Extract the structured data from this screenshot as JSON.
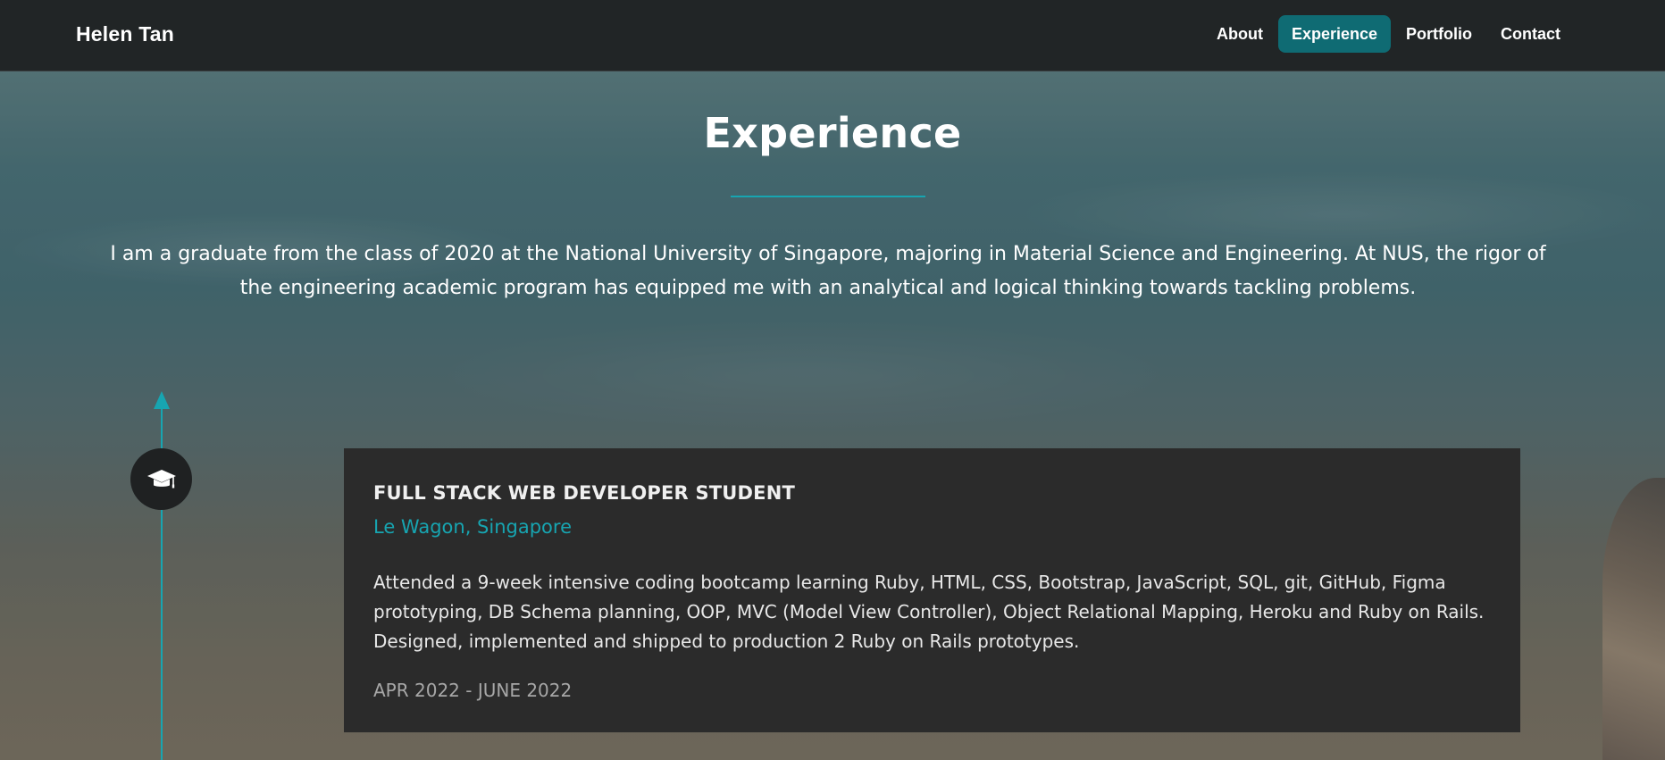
{
  "colors": {
    "navbar_bg": "#212526",
    "accent": "#17a5b1",
    "active_nav_bg": "#0f6b73",
    "card_bg": "#2b2b2b"
  },
  "brand": {
    "name": "Helen Tan"
  },
  "nav": {
    "items": [
      {
        "label": "About"
      },
      {
        "label": "Experience"
      },
      {
        "label": "Portfolio"
      },
      {
        "label": "Contact"
      }
    ],
    "active": "Experience"
  },
  "experience": {
    "title": "Experience",
    "intro": "I am a graduate from the class of 2020 at the National University of Singapore, majoring in Material Science and Engineering. At NUS, the rigor of the engineering academic program has equipped me with an analytical and logical thinking towards tackling problems.",
    "timeline": {
      "icon": "graduation-cap-icon"
    },
    "entries": [
      {
        "role": "FULL STACK WEB DEVELOPER STUDENT",
        "organization": "Le Wagon, Singapore",
        "description": "Attended a 9-week intensive coding bootcamp learning Ruby, HTML, CSS, Bootstrap, JavaScript, SQL, git, GitHub, Figma prototyping, DB Schema planning, OOP, MVC (Model View Controller), Object Relational Mapping, Heroku and Ruby on Rails. Designed, implemented and shipped to production 2 Ruby on Rails prototypes.",
        "dates": "APR 2022 - JUNE 2022"
      }
    ]
  }
}
